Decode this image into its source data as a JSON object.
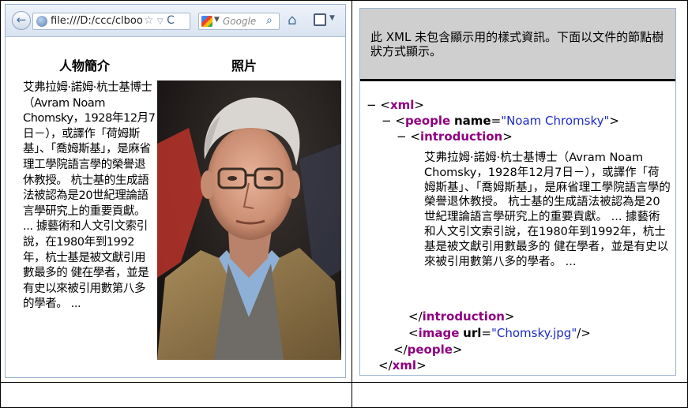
{
  "browser": {
    "url": "file:///D:/ccc/clboo",
    "search_placeholder": "Google"
  },
  "page": {
    "heading_intro": "人物簡介",
    "heading_photo": "照片",
    "intro_text": "艾弗拉姆·諾姆·杭士基博士（Avram Noam Chomsky，1928年12月7日－），或譯作「荷姆斯基」、「喬姆斯基」，是麻省理工學院語言學的榮譽退休教授。 杭士基的生成語法被認為是20世紀理論語言學研究上的重要貢獻。 ... 據藝術和人文引文索引說，在1980年到1992年，杭士基是被文獻引用數最多的 健在學者，並是有史以來被引用數第八多的學者。 ..."
  },
  "xml_viewer": {
    "notice": "此 XML 未包含顯示用的樣式資訊。下面以文件的節點樹狀方式顯示。",
    "minus": "−",
    "lt": "<",
    "gt": ">",
    "lt_slash": "</",
    "slash_gt": "/>",
    "eq": "=",
    "root_tag": "xml",
    "people_tag": "people",
    "people_attr_name": "name",
    "people_attr_value": "\"Noam Chromsky\"",
    "introduction_tag": "introduction",
    "introduction_text": "艾弗拉姆·諾姆·杭士基博士（Avram Noam Chomsky，1928年12月7日－），或譯作「荷姆斯基」、「喬姆斯基」，是麻省理工學院語言學的榮譽退休教授。 杭士基的生成語法被認為是20世紀理論語言學研究上的重要貢獻。 ... 據藝術和人文引文索引說，在1980年到1992年，杭士基是被文獻引用數最多的 健在學者，並是有史以來被引用數第八多的學者。 ...",
    "image_tag": "image",
    "image_attr_name": "url",
    "image_attr_value": "\"Chomsky.jpg\""
  },
  "icons": {
    "back": "back-arrow-icon",
    "site": "globe-icon",
    "bookmark": "star-icon",
    "reload": "reload-icon",
    "search_engine": "google-icon",
    "search": "magnifier-icon",
    "home": "home-icon",
    "menu": "window-menu-icon"
  }
}
